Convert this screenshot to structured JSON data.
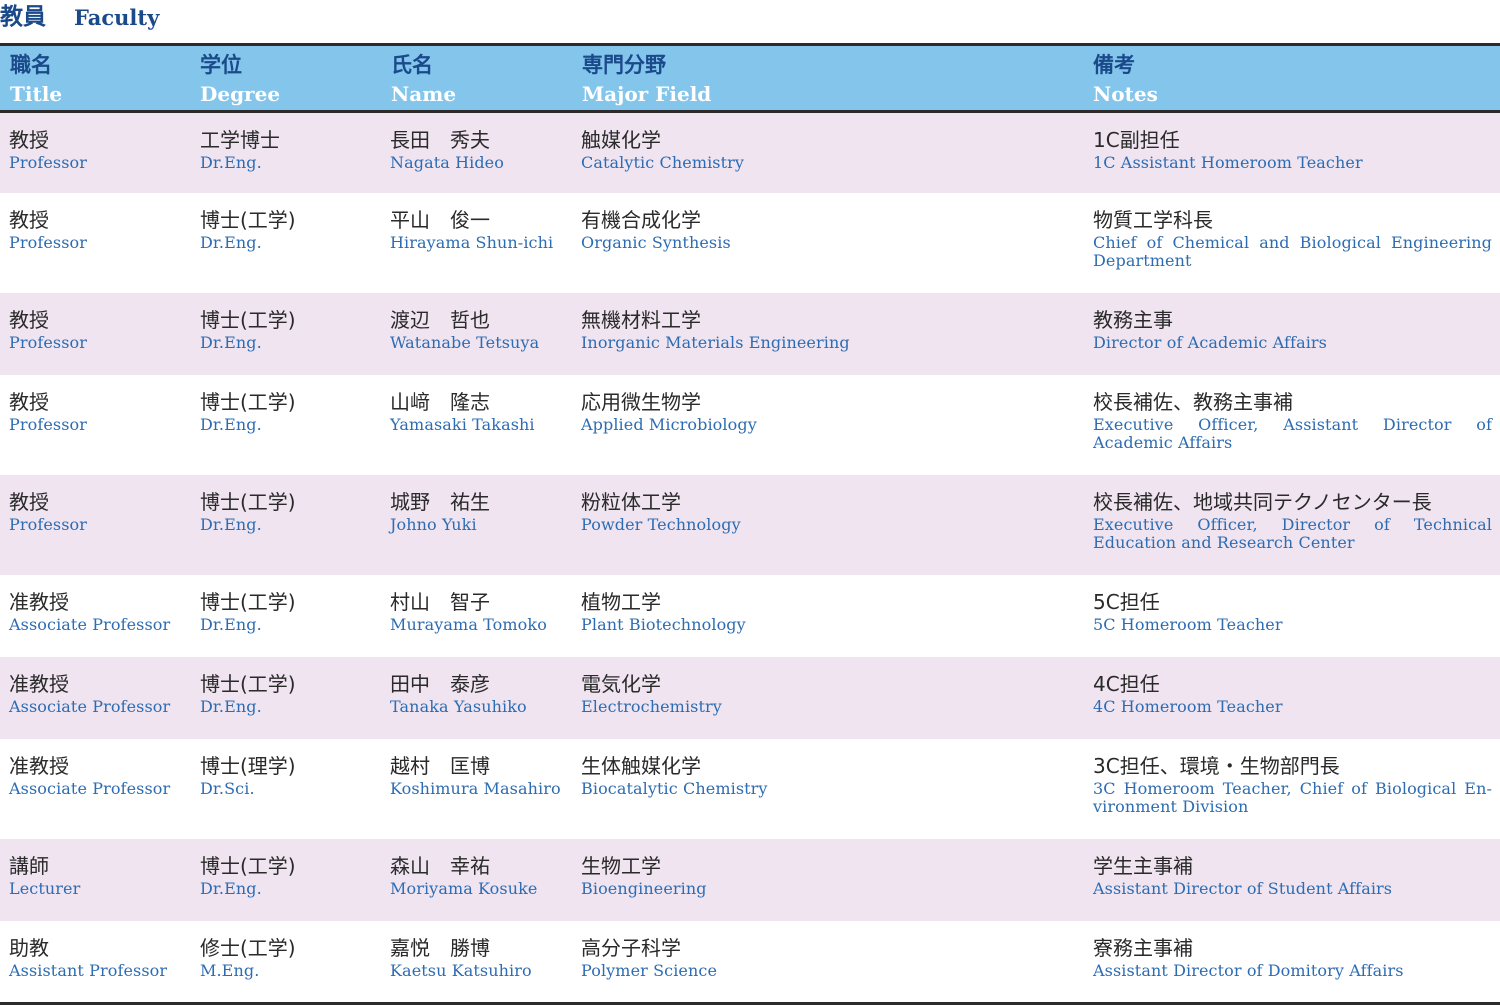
{
  "heading": {
    "ja": "教員",
    "en": "Faculty"
  },
  "columns": [
    {
      "ja": "職名",
      "en": "Title"
    },
    {
      "ja": "学位",
      "en": "Degree"
    },
    {
      "ja": "氏名",
      "en": "Name"
    },
    {
      "ja": "専門分野",
      "en": "Major Field"
    },
    {
      "ja": "備考",
      "en": "Notes"
    }
  ],
  "rows": [
    {
      "title_ja": "教授",
      "title_en": "Professor",
      "degree_ja": "工学博士",
      "degree_en": "Dr.Eng.",
      "name_ja": "長田　秀夫",
      "name_en": "Nagata Hideo",
      "field_ja": "触媒化学",
      "field_en": "Catalytic Chemistry",
      "notes_ja": "1C副担任",
      "notes_en": "1C Assistant Homeroom Teacher"
    },
    {
      "title_ja": "教授",
      "title_en": "Professor",
      "degree_ja": "博士(工学)",
      "degree_en": "Dr.Eng.",
      "name_ja": "平山　俊一",
      "name_en": "Hirayama Shun-ichi",
      "field_ja": "有機合成化学",
      "field_en": "Organic Synthesis",
      "notes_ja": "物質工学科長",
      "notes_en": "Chief of Chemical and Biological Engineering Department"
    },
    {
      "title_ja": "教授",
      "title_en": "Professor",
      "degree_ja": "博士(工学)",
      "degree_en": "Dr.Eng.",
      "name_ja": "渡辺　哲也",
      "name_en": "Watanabe Tetsuya",
      "field_ja": "無機材料工学",
      "field_en": "Inorganic Materials Engineering",
      "notes_ja": "教務主事",
      "notes_en": "Director of Academic Affairs"
    },
    {
      "title_ja": "教授",
      "title_en": "Professor",
      "degree_ja": "博士(工学)",
      "degree_en": "Dr.Eng.",
      "name_ja": "山﨑　隆志",
      "name_en": "Yamasaki Takashi",
      "field_ja": "応用微生物学",
      "field_en": "Applied Microbiology",
      "notes_ja": "校長補佐、教務主事補",
      "notes_en": "Executive Officer, Assistant Director of Academic Affairs"
    },
    {
      "title_ja": "教授",
      "title_en": "Professor",
      "degree_ja": "博士(工学)",
      "degree_en": "Dr.Eng.",
      "name_ja": "城野　祐生",
      "name_en": "Johno Yuki",
      "field_ja": "粉粒体工学",
      "field_en": "Powder Technology",
      "notes_ja": "校長補佐、地域共同テクノセンター長",
      "notes_en": "Executive Officer, Director of Technical Education and Research Center"
    },
    {
      "title_ja": "准教授",
      "title_en": "Associate Professor",
      "degree_ja": "博士(工学)",
      "degree_en": "Dr.Eng.",
      "name_ja": "村山　智子",
      "name_en": "Murayama Tomoko",
      "field_ja": "植物工学",
      "field_en": "Plant Biotechnology",
      "notes_ja": "5C担任",
      "notes_en": "5C Homeroom Teacher"
    },
    {
      "title_ja": "准教授",
      "title_en": "Associate Professor",
      "degree_ja": "博士(工学)",
      "degree_en": "Dr.Eng.",
      "name_ja": "田中　泰彦",
      "name_en": "Tanaka Yasuhiko",
      "field_ja": "電気化学",
      "field_en": "Electrochemistry",
      "notes_ja": "4C担任",
      "notes_en": "4C Homeroom Teacher"
    },
    {
      "title_ja": "准教授",
      "title_en": "Associate Professor",
      "degree_ja": "博士(理学)",
      "degree_en": "Dr.Sci.",
      "name_ja": "越村　匡博",
      "name_en": "Koshimura Masahiro",
      "field_ja": "生体触媒化学",
      "field_en": "Biocatalytic Chemistry",
      "notes_ja": "3C担任、環境・生物部門長",
      "notes_en": "3C Homeroom Teacher, Chief of Biological En-vironment Division"
    },
    {
      "title_ja": "講師",
      "title_en": "Lecturer",
      "degree_ja": "博士(工学)",
      "degree_en": "Dr.Eng.",
      "name_ja": "森山　幸祐",
      "name_en": "Moriyama Kosuke",
      "field_ja": "生物工学",
      "field_en": "Bioengineering",
      "notes_ja": "学生主事補",
      "notes_en": "Assistant Director of Student Affairs"
    },
    {
      "title_ja": "助教",
      "title_en": "Assistant Professor",
      "degree_ja": "修士(工学)",
      "degree_en": "M.Eng.",
      "name_ja": "嘉悦　勝博",
      "name_en": "Kaetsu Katsuhiro",
      "field_ja": "高分子科学",
      "field_en": "Polymer Science",
      "notes_ja": "寮務主事補",
      "notes_en": "Assistant Director of Domitory Affairs"
    }
  ]
}
